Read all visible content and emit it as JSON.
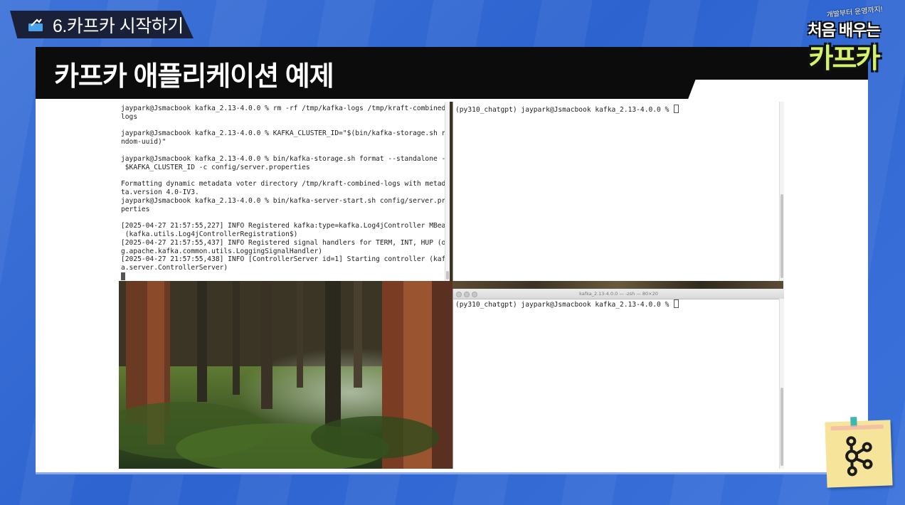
{
  "section": {
    "label": "6.카프카 시작하기",
    "icon": "kafka-section-icon"
  },
  "slide": {
    "title": "카프카 애플리케이션 예제"
  },
  "logo": {
    "tagline": "개발부터 운영까지!",
    "line1": "처음 배우는",
    "line2": "카프카"
  },
  "terminals": {
    "top_left": {
      "lines": [
        "jaypark@Jsmacbook kafka_2.13-4.0.0 % rm -rf /tmp/kafka-logs /tmp/kraft-combined-",
        "logs",
        "",
        "jaypark@Jsmacbook kafka_2.13-4.0.0 % KAFKA_CLUSTER_ID=\"$(bin/kafka-storage.sh ra",
        "ndom-uuid)\"",
        "",
        "jaypark@Jsmacbook kafka_2.13-4.0.0 % bin/kafka-storage.sh format --standalone -t",
        " $KAFKA_CLUSTER_ID -c config/server.properties",
        "",
        "Formatting dynamic metadata voter directory /tmp/kraft-combined-logs with metada",
        "ta.version 4.0-IV3.",
        "jaypark@Jsmacbook kafka_2.13-4.0.0 % bin/kafka-server-start.sh config/server.pro",
        "perties",
        "",
        "[2025-04-27 21:57:55,227] INFO Registered kafka:type=kafka.Log4jController MBean",
        " (kafka.utils.Log4jControllerRegistration$)",
        "[2025-04-27 21:57:55,437] INFO Registered signal handlers for TERM, INT, HUP (or",
        "g.apache.kafka.common.utils.LoggingSignalHandler)",
        "[2025-04-27 21:57:55,438] INFO [ControllerServer id=1] Starting controller (kafk",
        "a.server.ControllerServer)"
      ]
    },
    "top_right": {
      "prompt": "(py310_chatgpt) jaypark@Jsmacbook kafka_2.13-4.0.0 % "
    },
    "bottom_right": {
      "window_title": "kafka_2.13-4.0.0 — -zsh — 80×20",
      "prompt": "(py310_chatgpt) jaypark@Jsmacbook kafka_2.13-4.0.0 % "
    }
  },
  "sticky_note": {
    "icon": "kafka-logo-icon"
  },
  "colors": {
    "accent_green": "#d3f36b",
    "title_bg": "#0c0c0c",
    "sticky": "#f7e49b"
  }
}
